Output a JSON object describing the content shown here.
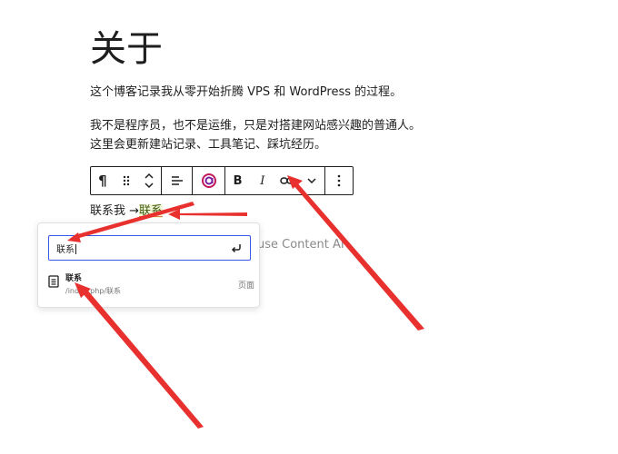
{
  "page": {
    "title": "关于",
    "para1": "这个博客记录我从零开始折腾 VPS 和 WordPress 的过程。",
    "para2_line1": "我不是程序员，也不是运维，只是对搭建网站感兴趣的普通人。",
    "para2_line2": "这里会更新建站记录、工具笔记、踩坑经历。",
    "line3_prefix": "联系我 →",
    "line3_link": "联系",
    "placeholder_fragment": "use Content AI"
  },
  "toolbar": {
    "paragraph_glyph": "¶",
    "bold": "B",
    "italic": "I"
  },
  "link_popover": {
    "search_value": "联系",
    "result_title": "联系",
    "result_url": "/index.php/联系",
    "result_type": "页面"
  },
  "colors": {
    "accent": "#3858e9",
    "annotation_arrow": "#e8312f",
    "link_highlight": "#f1f6d4"
  }
}
